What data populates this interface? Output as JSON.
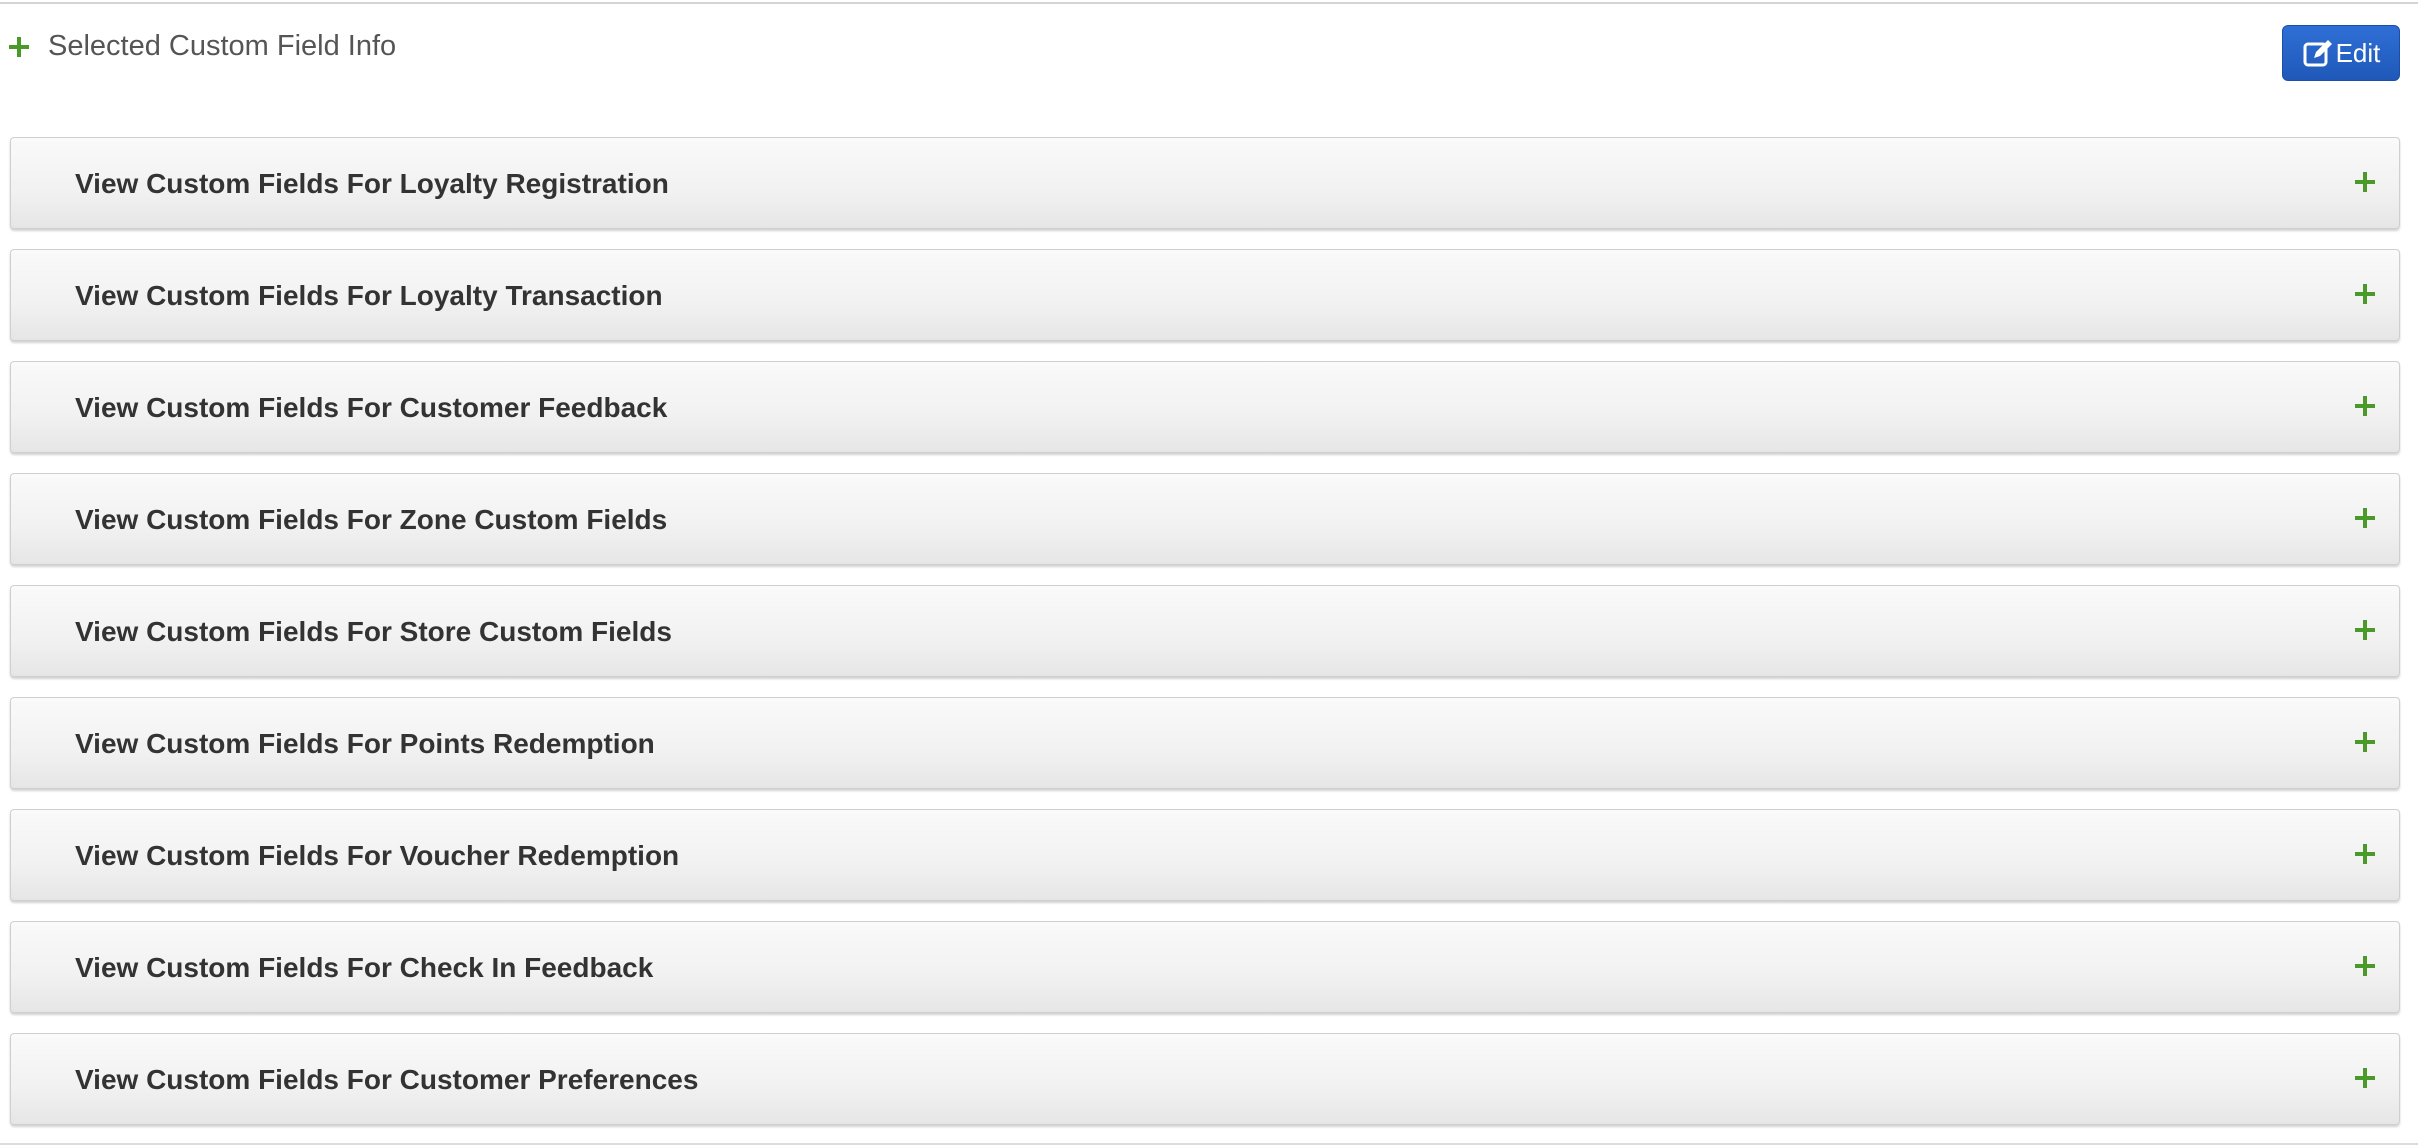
{
  "header": {
    "title": "Selected Custom Field Info",
    "edit_label": "Edit",
    "expand_icon": "plus-icon",
    "edit_icon": "edit-icon"
  },
  "colors": {
    "accent_green": "#4a9a2a",
    "edit_blue": "#2563c9",
    "panel_text": "#333333"
  },
  "panels": [
    {
      "label": "View Custom Fields For Loyalty Registration"
    },
    {
      "label": "View Custom Fields For Loyalty Transaction"
    },
    {
      "label": "View Custom Fields For Customer Feedback"
    },
    {
      "label": "View Custom Fields For Zone Custom Fields"
    },
    {
      "label": "View Custom Fields For Store Custom Fields"
    },
    {
      "label": "View Custom Fields For Points Redemption"
    },
    {
      "label": "View Custom Fields For Voucher Redemption"
    },
    {
      "label": "View Custom Fields For Check In Feedback"
    },
    {
      "label": "View Custom Fields For Customer Preferences"
    }
  ]
}
